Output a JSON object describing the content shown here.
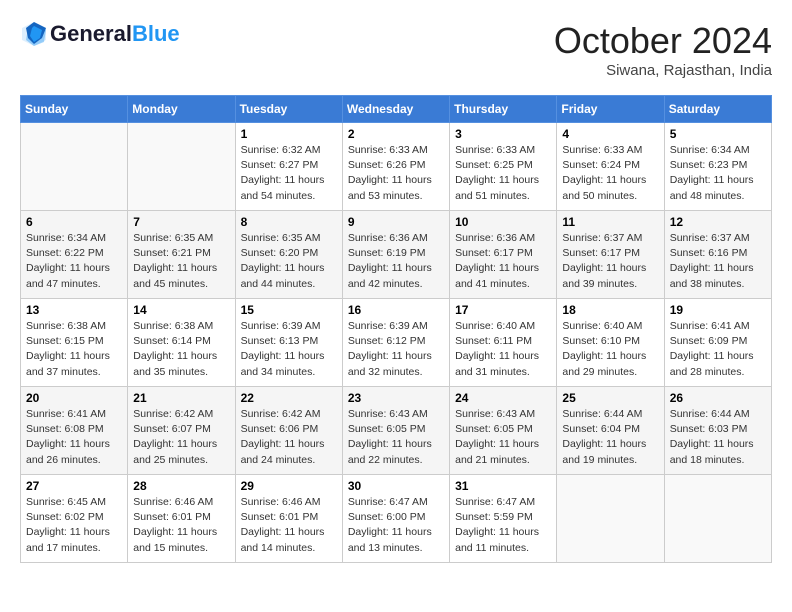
{
  "header": {
    "logo_line1": "General",
    "logo_line2": "Blue",
    "month": "October 2024",
    "location": "Siwana, Rajasthan, India"
  },
  "days_of_week": [
    "Sunday",
    "Monday",
    "Tuesday",
    "Wednesday",
    "Thursday",
    "Friday",
    "Saturday"
  ],
  "weeks": [
    [
      {
        "day": "",
        "info": ""
      },
      {
        "day": "",
        "info": ""
      },
      {
        "day": "1",
        "info": "Sunrise: 6:32 AM\nSunset: 6:27 PM\nDaylight: 11 hours and 54 minutes."
      },
      {
        "day": "2",
        "info": "Sunrise: 6:33 AM\nSunset: 6:26 PM\nDaylight: 11 hours and 53 minutes."
      },
      {
        "day": "3",
        "info": "Sunrise: 6:33 AM\nSunset: 6:25 PM\nDaylight: 11 hours and 51 minutes."
      },
      {
        "day": "4",
        "info": "Sunrise: 6:33 AM\nSunset: 6:24 PM\nDaylight: 11 hours and 50 minutes."
      },
      {
        "day": "5",
        "info": "Sunrise: 6:34 AM\nSunset: 6:23 PM\nDaylight: 11 hours and 48 minutes."
      }
    ],
    [
      {
        "day": "6",
        "info": "Sunrise: 6:34 AM\nSunset: 6:22 PM\nDaylight: 11 hours and 47 minutes."
      },
      {
        "day": "7",
        "info": "Sunrise: 6:35 AM\nSunset: 6:21 PM\nDaylight: 11 hours and 45 minutes."
      },
      {
        "day": "8",
        "info": "Sunrise: 6:35 AM\nSunset: 6:20 PM\nDaylight: 11 hours and 44 minutes."
      },
      {
        "day": "9",
        "info": "Sunrise: 6:36 AM\nSunset: 6:19 PM\nDaylight: 11 hours and 42 minutes."
      },
      {
        "day": "10",
        "info": "Sunrise: 6:36 AM\nSunset: 6:17 PM\nDaylight: 11 hours and 41 minutes."
      },
      {
        "day": "11",
        "info": "Sunrise: 6:37 AM\nSunset: 6:17 PM\nDaylight: 11 hours and 39 minutes."
      },
      {
        "day": "12",
        "info": "Sunrise: 6:37 AM\nSunset: 6:16 PM\nDaylight: 11 hours and 38 minutes."
      }
    ],
    [
      {
        "day": "13",
        "info": "Sunrise: 6:38 AM\nSunset: 6:15 PM\nDaylight: 11 hours and 37 minutes."
      },
      {
        "day": "14",
        "info": "Sunrise: 6:38 AM\nSunset: 6:14 PM\nDaylight: 11 hours and 35 minutes."
      },
      {
        "day": "15",
        "info": "Sunrise: 6:39 AM\nSunset: 6:13 PM\nDaylight: 11 hours and 34 minutes."
      },
      {
        "day": "16",
        "info": "Sunrise: 6:39 AM\nSunset: 6:12 PM\nDaylight: 11 hours and 32 minutes."
      },
      {
        "day": "17",
        "info": "Sunrise: 6:40 AM\nSunset: 6:11 PM\nDaylight: 11 hours and 31 minutes."
      },
      {
        "day": "18",
        "info": "Sunrise: 6:40 AM\nSunset: 6:10 PM\nDaylight: 11 hours and 29 minutes."
      },
      {
        "day": "19",
        "info": "Sunrise: 6:41 AM\nSunset: 6:09 PM\nDaylight: 11 hours and 28 minutes."
      }
    ],
    [
      {
        "day": "20",
        "info": "Sunrise: 6:41 AM\nSunset: 6:08 PM\nDaylight: 11 hours and 26 minutes."
      },
      {
        "day": "21",
        "info": "Sunrise: 6:42 AM\nSunset: 6:07 PM\nDaylight: 11 hours and 25 minutes."
      },
      {
        "day": "22",
        "info": "Sunrise: 6:42 AM\nSunset: 6:06 PM\nDaylight: 11 hours and 24 minutes."
      },
      {
        "day": "23",
        "info": "Sunrise: 6:43 AM\nSunset: 6:05 PM\nDaylight: 11 hours and 22 minutes."
      },
      {
        "day": "24",
        "info": "Sunrise: 6:43 AM\nSunset: 6:05 PM\nDaylight: 11 hours and 21 minutes."
      },
      {
        "day": "25",
        "info": "Sunrise: 6:44 AM\nSunset: 6:04 PM\nDaylight: 11 hours and 19 minutes."
      },
      {
        "day": "26",
        "info": "Sunrise: 6:44 AM\nSunset: 6:03 PM\nDaylight: 11 hours and 18 minutes."
      }
    ],
    [
      {
        "day": "27",
        "info": "Sunrise: 6:45 AM\nSunset: 6:02 PM\nDaylight: 11 hours and 17 minutes."
      },
      {
        "day": "28",
        "info": "Sunrise: 6:46 AM\nSunset: 6:01 PM\nDaylight: 11 hours and 15 minutes."
      },
      {
        "day": "29",
        "info": "Sunrise: 6:46 AM\nSunset: 6:01 PM\nDaylight: 11 hours and 14 minutes."
      },
      {
        "day": "30",
        "info": "Sunrise: 6:47 AM\nSunset: 6:00 PM\nDaylight: 11 hours and 13 minutes."
      },
      {
        "day": "31",
        "info": "Sunrise: 6:47 AM\nSunset: 5:59 PM\nDaylight: 11 hours and 11 minutes."
      },
      {
        "day": "",
        "info": ""
      },
      {
        "day": "",
        "info": ""
      }
    ]
  ]
}
